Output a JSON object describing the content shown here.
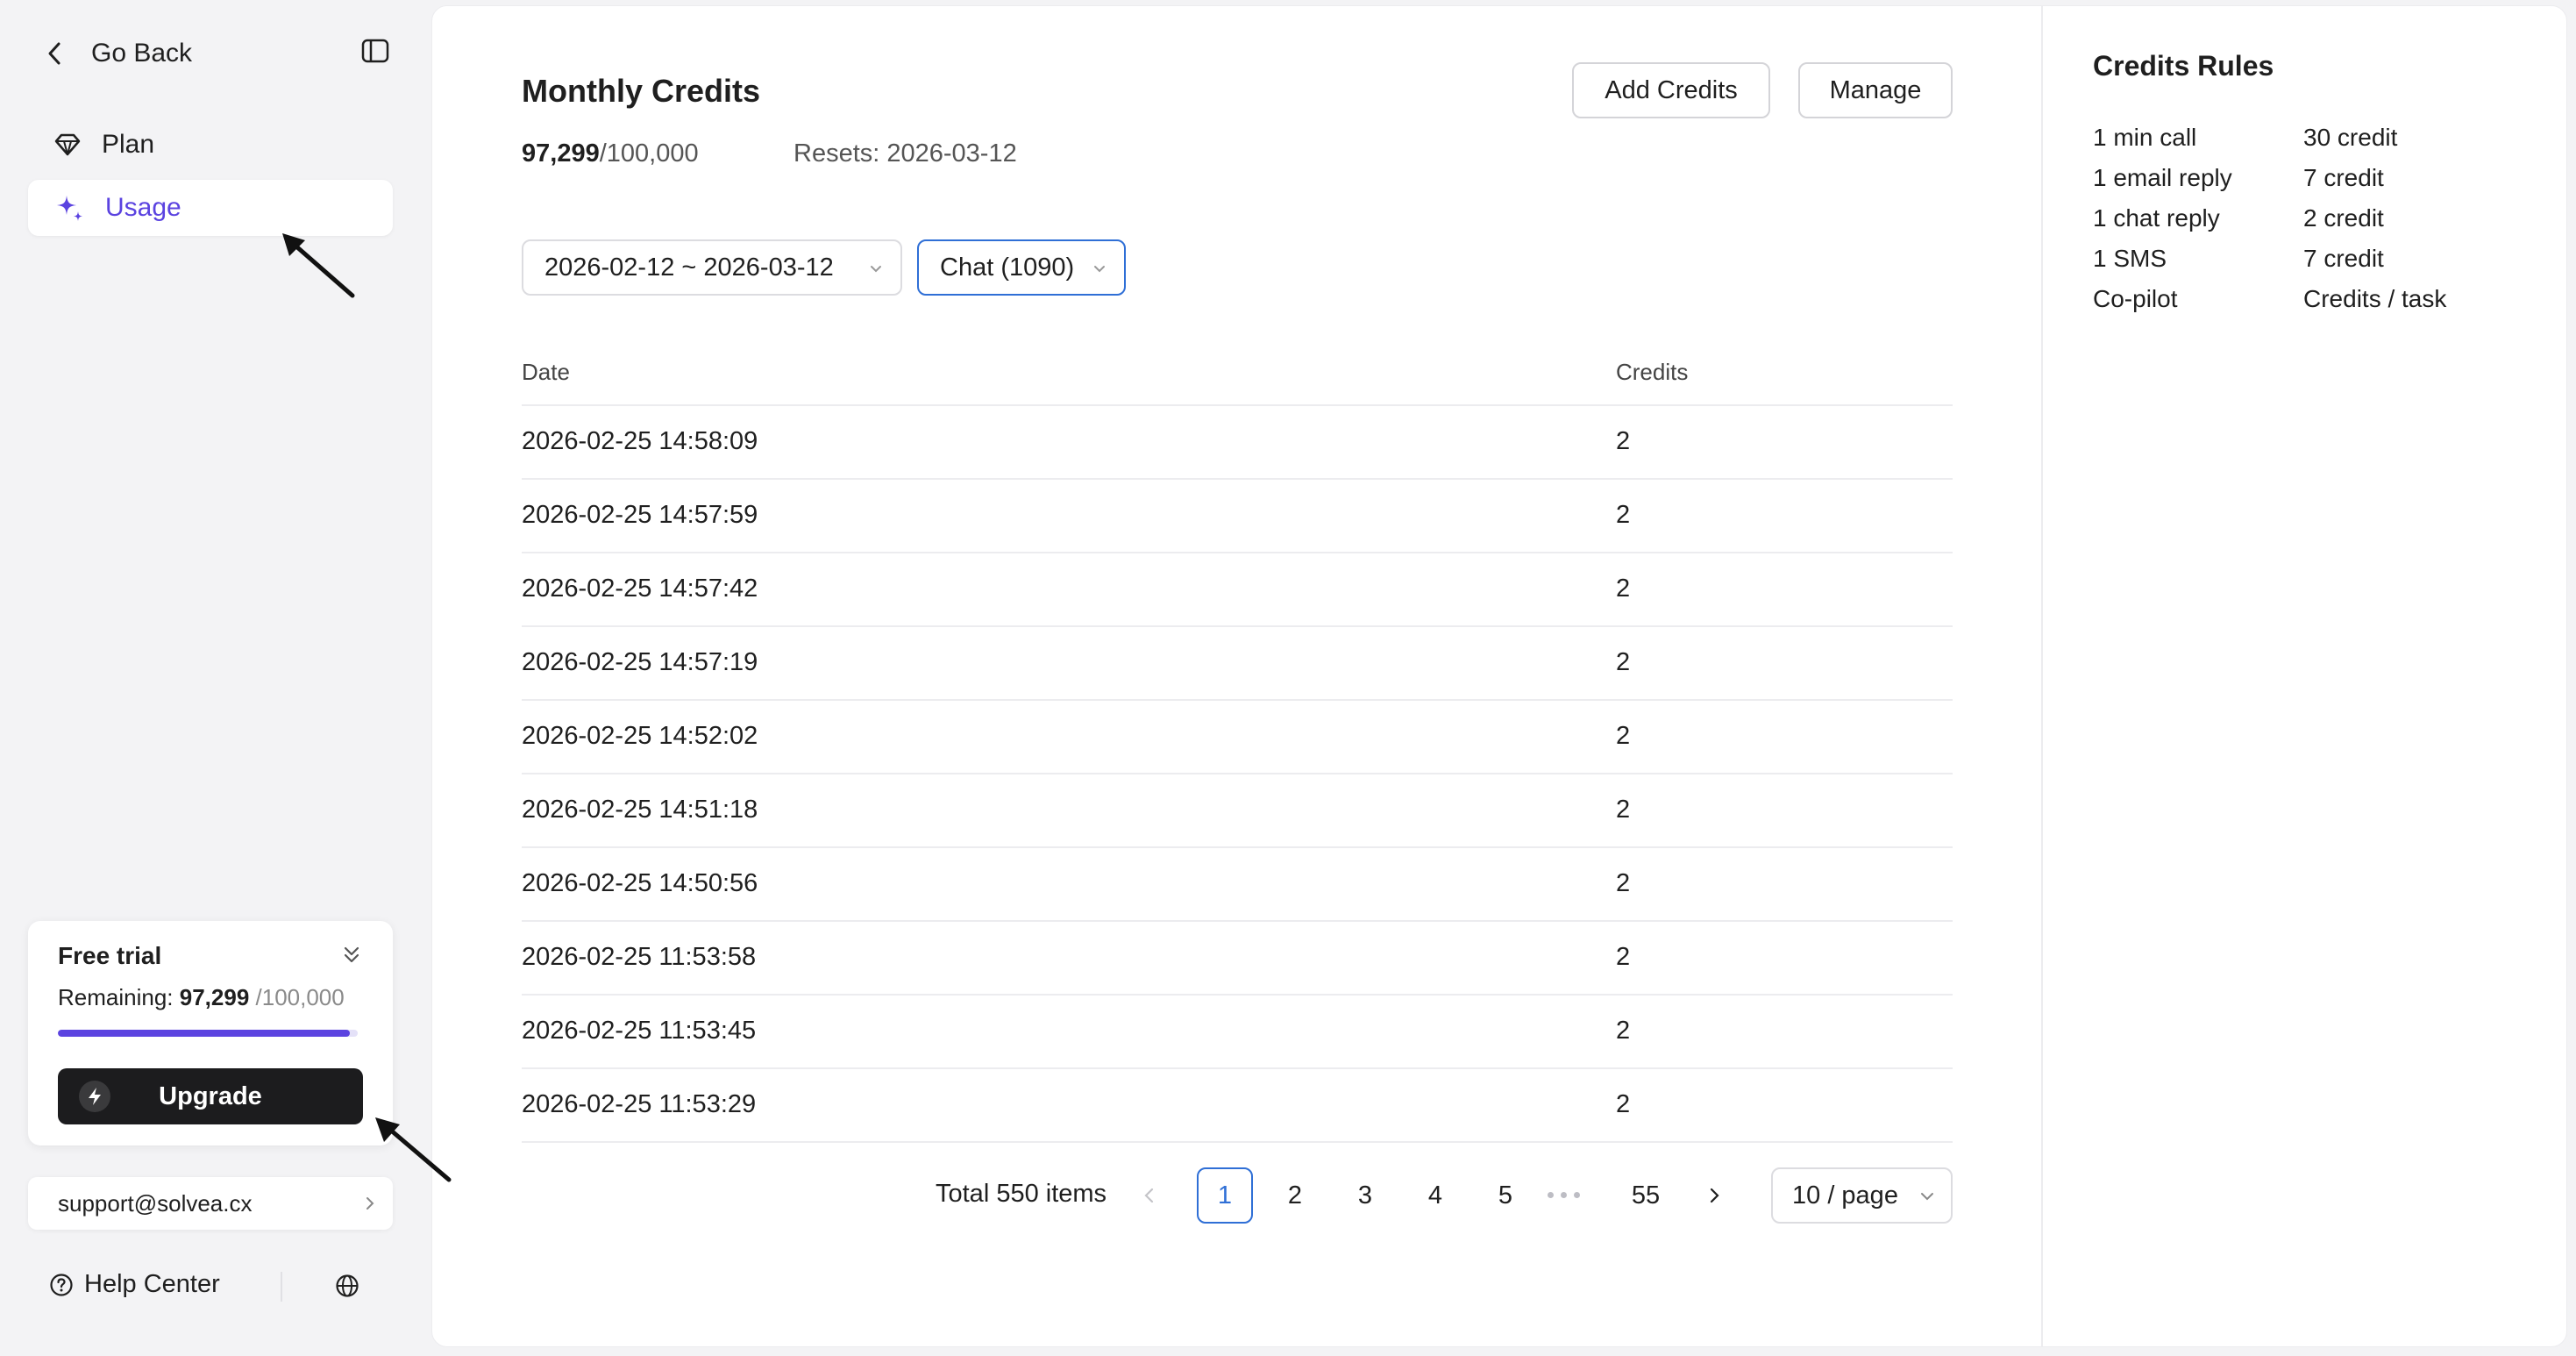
{
  "sidebar": {
    "go_back": "Go Back",
    "nav": [
      {
        "label": "Plan",
        "icon": "diamond-icon"
      },
      {
        "label": "Usage",
        "icon": "sparkle-icon"
      }
    ],
    "trial": {
      "title": "Free trial",
      "remaining_label": "Remaining:",
      "remaining": "97,299",
      "total": "/100,000",
      "progress_fraction": 0.973,
      "upgrade_label": "Upgrade"
    },
    "support_email": "support@solvea.cx",
    "help_center": "Help Center"
  },
  "main": {
    "title": "Monthly Credits",
    "credits_used": "97,299",
    "credits_total": "/100,000",
    "resets": "Resets: 2026-03-12",
    "add_credits_label": "Add Credits",
    "manage_label": "Manage",
    "date_filter": "2026-02-12 ~ 2026-03-12",
    "type_filter": "Chat (1090)",
    "table": {
      "headers": [
        "Date",
        "Credits"
      ],
      "rows": [
        [
          "2026-02-25 14:58:09",
          "2"
        ],
        [
          "2026-02-25 14:57:59",
          "2"
        ],
        [
          "2026-02-25 14:57:42",
          "2"
        ],
        [
          "2026-02-25 14:57:19",
          "2"
        ],
        [
          "2026-02-25 14:52:02",
          "2"
        ],
        [
          "2026-02-25 14:51:18",
          "2"
        ],
        [
          "2026-02-25 14:50:56",
          "2"
        ],
        [
          "2026-02-25 11:53:58",
          "2"
        ],
        [
          "2026-02-25 11:53:45",
          "2"
        ],
        [
          "2026-02-25 11:53:29",
          "2"
        ]
      ]
    },
    "pagination": {
      "total": "Total 550 items",
      "pages": [
        "1",
        "2",
        "3",
        "4",
        "5"
      ],
      "last_page": "55",
      "current": "1",
      "page_size": "10 / page"
    }
  },
  "rules": {
    "title": "Credits Rules",
    "items": [
      {
        "name": "1 min call",
        "value": "30 credit"
      },
      {
        "name": "1 email reply",
        "value": "7 credit"
      },
      {
        "name": "1 chat reply",
        "value": "2 credit"
      },
      {
        "name": "1 SMS",
        "value": "7 credit"
      },
      {
        "name": "Co-pilot",
        "value": "Credits / task"
      }
    ]
  },
  "colors": {
    "accent": "#5b43e0",
    "link_blue": "#2f6fd6",
    "upgrade_bg": "#1c1c1e"
  }
}
